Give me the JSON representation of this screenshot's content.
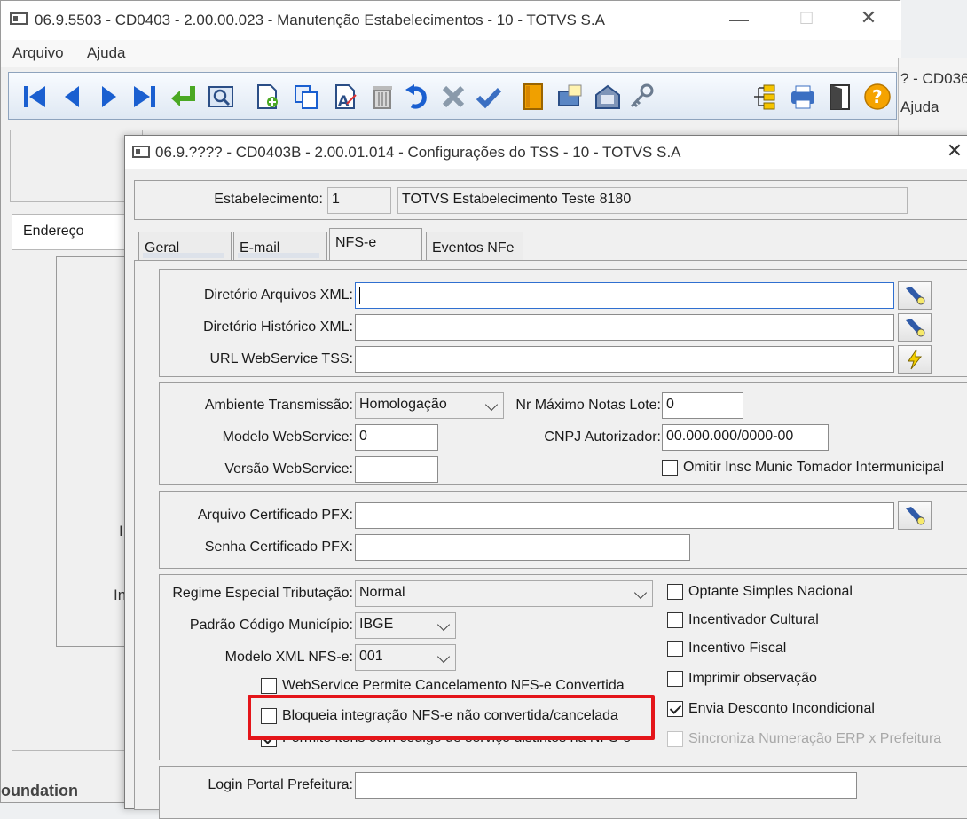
{
  "bg_window": {
    "title": "06.9.5503 - CD0403 - 2.00.00.023 - Manutenção Estabelecimentos - 10 - TOTVS S.A",
    "menu": [
      "Arquivo",
      "Ajuda"
    ],
    "tab_label": "Endereço",
    "fragments": [
      "I",
      "In"
    ],
    "footer_fragment": "oundation"
  },
  "right_window": {
    "title_fragment": "? - CD036",
    "menu_fragment": "Ajuda"
  },
  "dialog": {
    "title": "06.9.???? - CD0403B - 2.00.01.014 - Configurações do TSS - 10 - TOTVS S.A",
    "estabelecimento": {
      "label": "Estabelecimento:",
      "code": "1",
      "name": "TOTVS Estabelecimento Teste 8180"
    },
    "tabs": [
      {
        "label": "Geral"
      },
      {
        "label": "E-mail"
      },
      {
        "label": "NFS-e"
      },
      {
        "label": "Eventos NFe"
      }
    ],
    "dirs": {
      "xml_dir_label": "Diretório Arquivos XML:",
      "xml_dir_value": "",
      "hist_dir_label": "Diretório Histórico XML:",
      "hist_dir_value": "",
      "url_label": "URL WebService TSS:",
      "url_value": ""
    },
    "transmission": {
      "ambiente_label": "Ambiente Transmissão:",
      "ambiente_value": "Homologação",
      "nr_max_label": "Nr Máximo Notas Lote:",
      "nr_max_value": "0",
      "modelo_ws_label": "Modelo WebService:",
      "modelo_ws_value": "0",
      "cnpj_label": "CNPJ Autorizador:",
      "cnpj_value": "00.000.000/0000-00",
      "versao_ws_label": "Versão WebService:",
      "versao_ws_value": "",
      "omitir_label": "Omitir Insc Munic Tomador Intermunicipal",
      "omitir_checked": false
    },
    "cert": {
      "pfx_label": "Arquivo Certificado PFX:",
      "pfx_value": "",
      "senha_label": "Senha Certificado PFX:",
      "senha_value": ""
    },
    "tributacao": {
      "regime_label": "Regime Especial Tributação:",
      "regime_value": "Normal",
      "padrao_label": "Padrão Código Município:",
      "padrao_value": "IBGE",
      "modelo_xml_label": "Modelo XML NFS-e:",
      "modelo_xml_value": "001",
      "ws_cancel_label": "WebService Permite Cancelamento NFS-e Convertida",
      "bloqueia_label": "Bloqueia integração NFS-e não convertida/cancelada",
      "permite_label": "Permite itens com código de serviço distintos na NFS-e",
      "optante_label": "Optante Simples Nacional",
      "incentivador_label": "Incentivador Cultural",
      "incentivo_label": "Incentivo Fiscal",
      "imprimir_label": "Imprimir observação",
      "envia_label": "Envia Desconto Incondicional",
      "sincroniza_label": "Sincroniza Numeração ERP x Prefeitura"
    },
    "login": {
      "label": "Login Portal Prefeitura:",
      "value": ""
    }
  },
  "colors": {
    "highlight": "#e4151a",
    "toolbar_accent": "#1a5fd0",
    "help_icon": "#f5a300"
  }
}
